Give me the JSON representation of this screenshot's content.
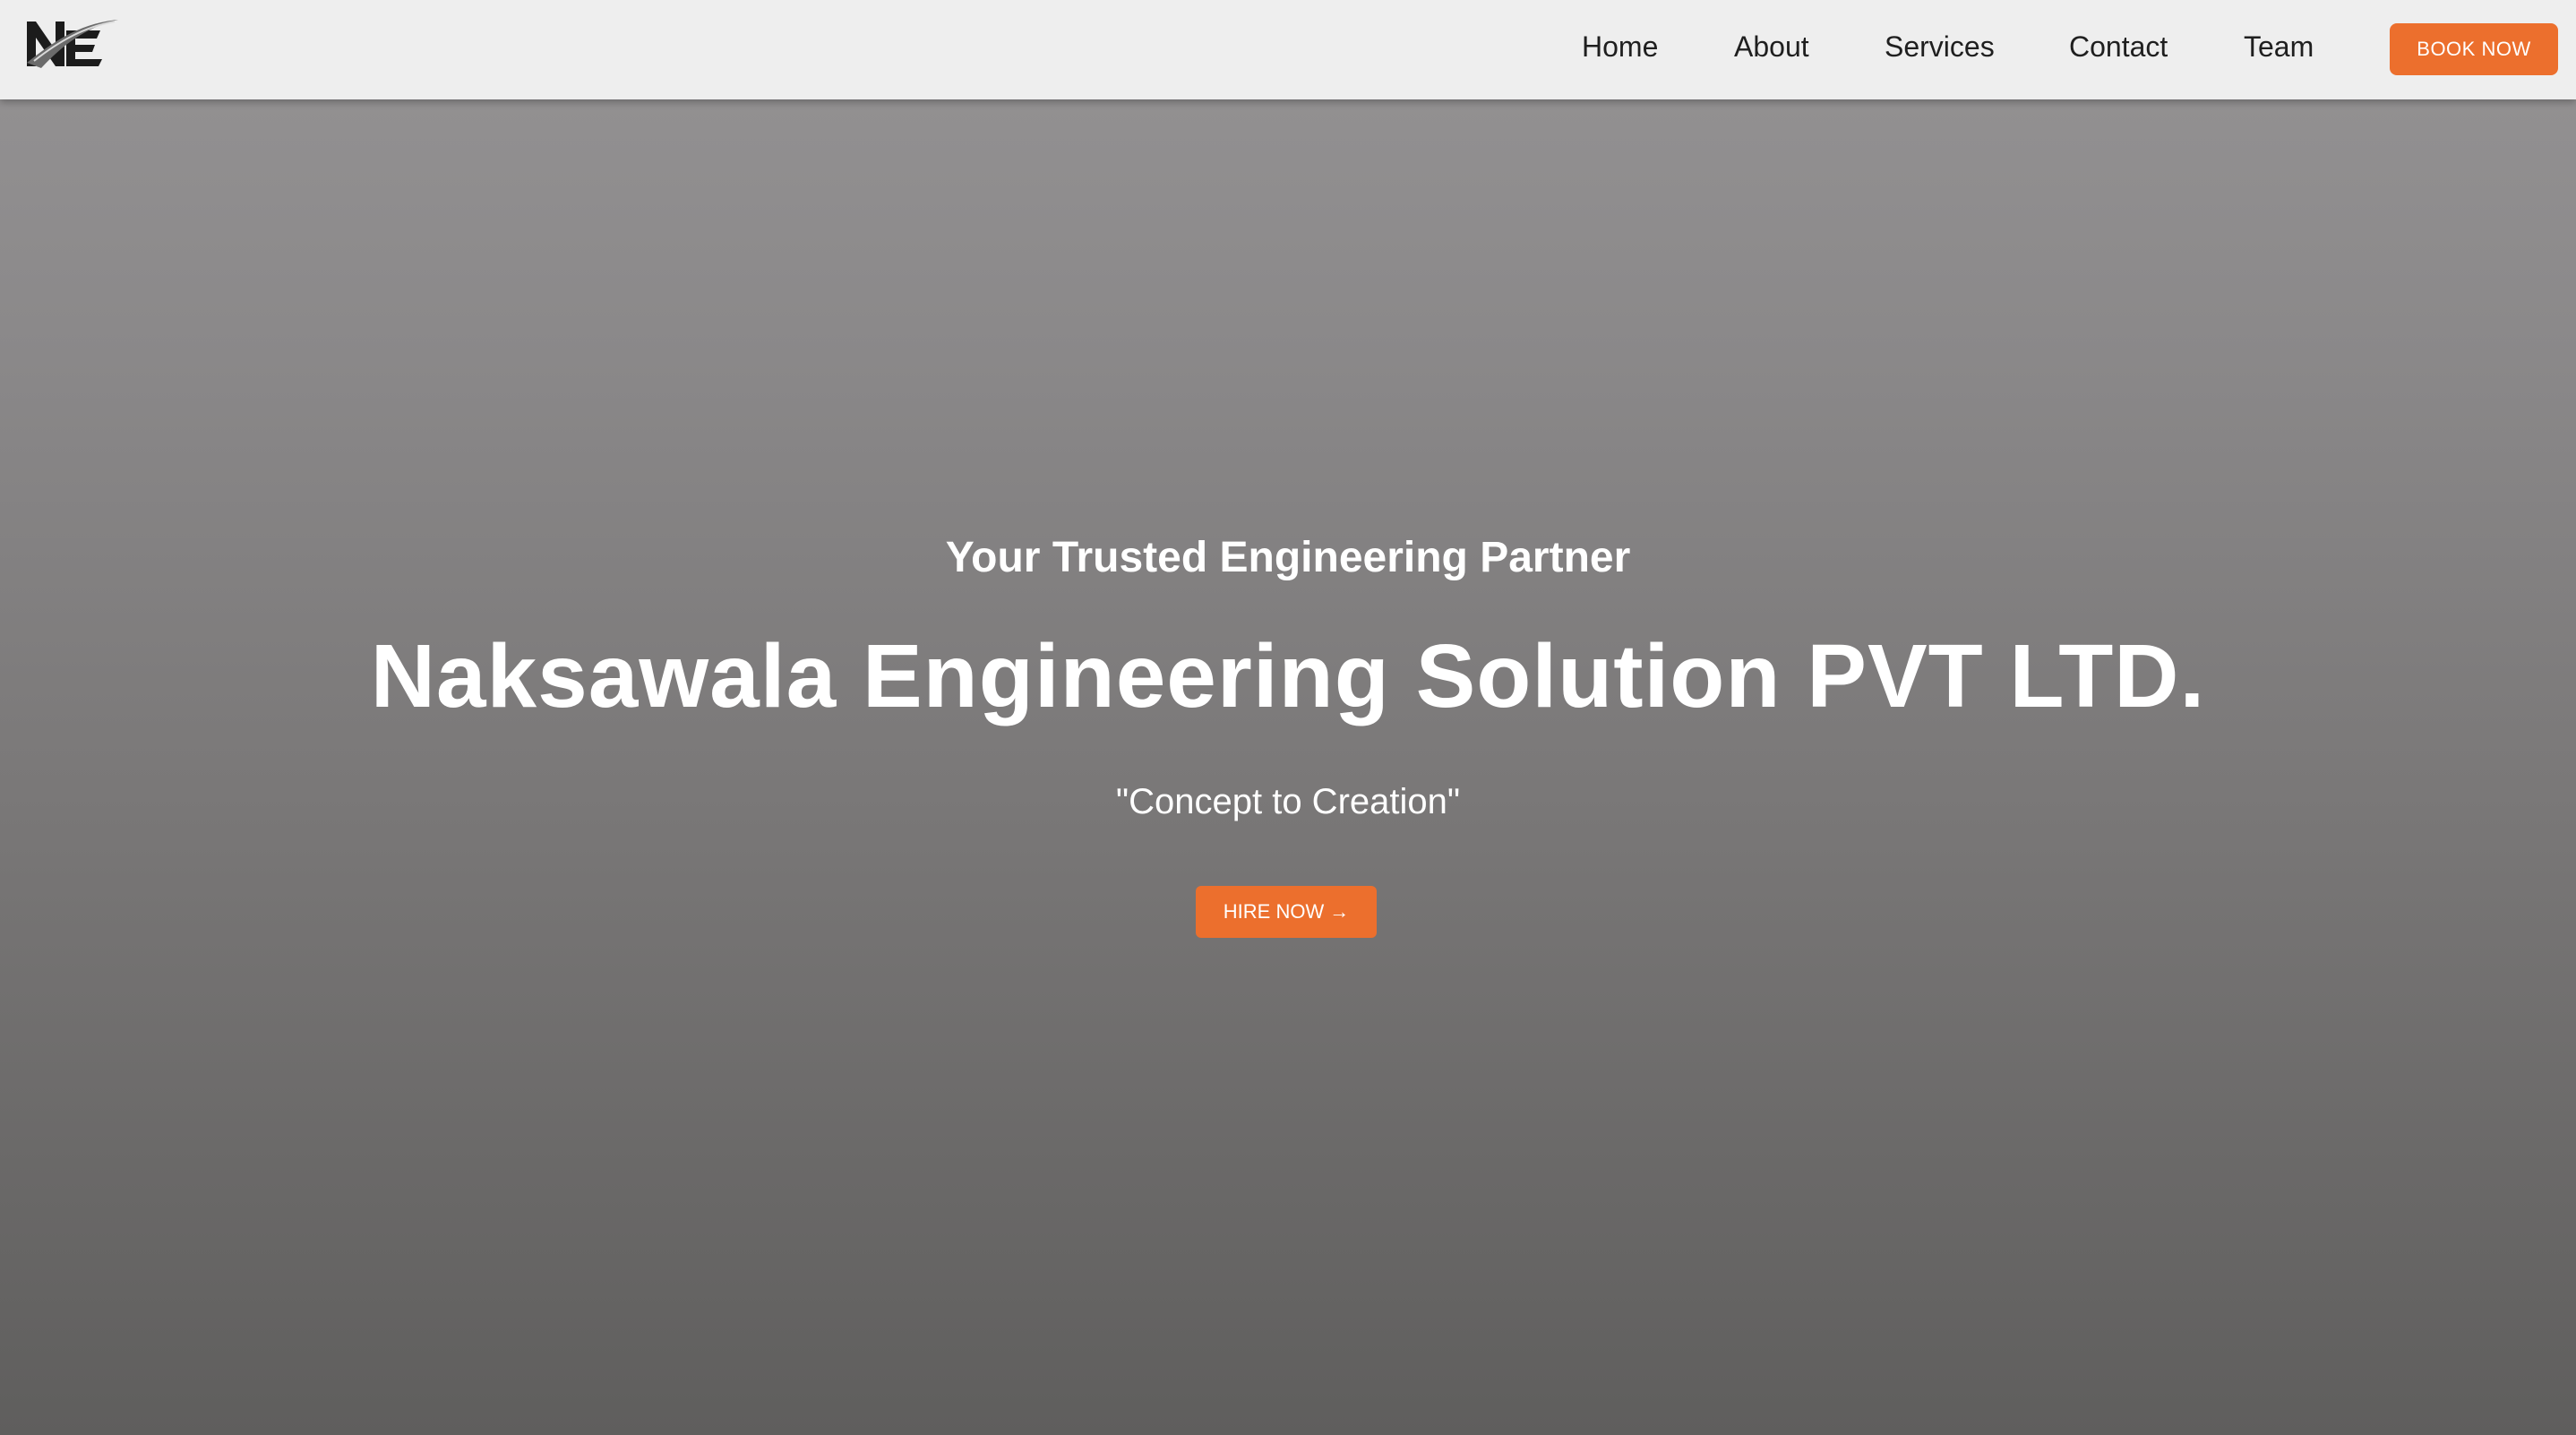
{
  "navbar": {
    "logo_text": "NE",
    "links": [
      {
        "label": "Home"
      },
      {
        "label": "About"
      },
      {
        "label": "Services"
      },
      {
        "label": "Contact"
      },
      {
        "label": "Team"
      }
    ],
    "book_label": "BOOK NOW"
  },
  "hero": {
    "subtitle": "Your Trusted Engineering Partner",
    "headline": "Naksawala Engineering Solution PVT LTD.",
    "tagline": "\"Concept to Creation\"",
    "hire_label": "HIRE NOW",
    "hire_icon": "arrow-right-icon"
  },
  "colors": {
    "accent": "#ec6f2d",
    "navbar_bg": "#eeeeee",
    "hero_text": "#ffffff"
  }
}
